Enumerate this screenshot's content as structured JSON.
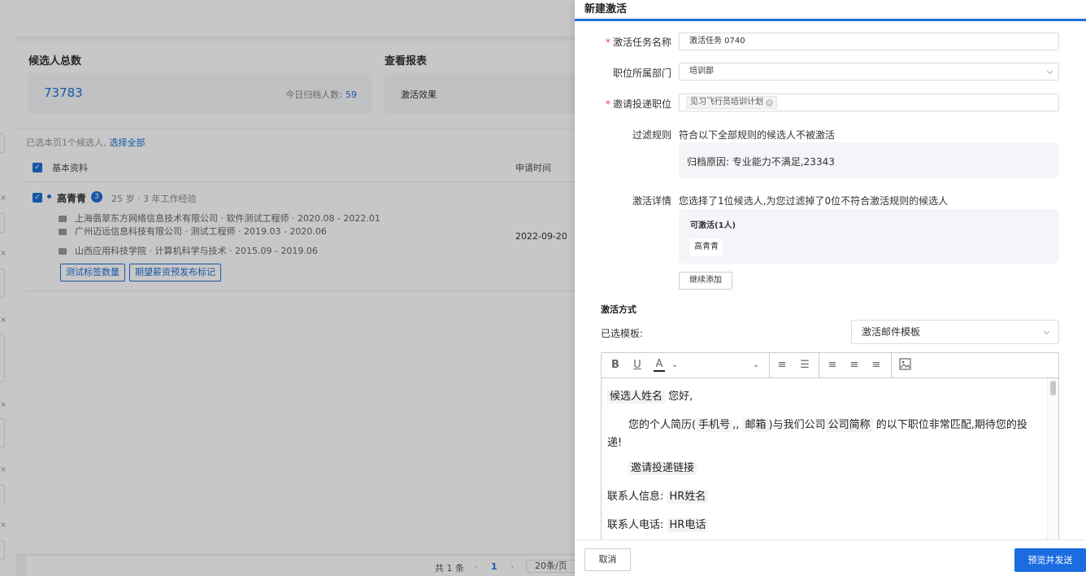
{
  "background": {
    "stats": {
      "total_title": "候选人总数",
      "total_value": "73783",
      "today_label": "今日归档人数:",
      "today_value": "59",
      "report_title": "查看报表",
      "report_item": "激活效果"
    },
    "selection": {
      "info": "已选本页1个候选人,",
      "select_all": "选择全部"
    },
    "table": {
      "col_basic": "基本资料",
      "col_apply_time": "申请时间"
    },
    "candidate": {
      "name": "高青青",
      "badge": "3",
      "meta": "25 岁 · 3 年工作经验",
      "experiences": [
        "上海翡翠东方网络信息技术有限公司 · 软件测试工程师 · 2020.08 - 2022.01",
        "广州迈远信息科技有限公司 · 测试工程师 · 2019.03 - 2020.06",
        "山西应用科技学院 · 计算机科学与技术 · 2015.09 - 2019.06"
      ],
      "tags": [
        "测试标签数量",
        "期望薪资预发布标记"
      ],
      "apply_date": "2022-09-20"
    },
    "pager": {
      "total": "共 1 条",
      "prev": "‹",
      "current": "1",
      "next": "›",
      "page_size": "20条/页"
    }
  },
  "drawer": {
    "title": "新建激活",
    "task_name": {
      "label": "激活任务名称",
      "value": "激活任务 0740"
    },
    "department": {
      "label": "职位所属部门",
      "value": "培训部"
    },
    "position": {
      "label": "邀请投递职位",
      "chip": "见习飞行员培训计划"
    },
    "filter_rules": {
      "label": "过滤规则",
      "desc": "符合以下全部规则的候选人不被激活",
      "rule": "归档原因: 专业能力不满足,23343"
    },
    "details": {
      "label": "激活详情",
      "desc": "您选择了1位候选人,为您过滤掉了0位不符合激活规则的候选人",
      "activatable": "可激活(1人)",
      "person": "高青青",
      "add_more": "继续添加"
    },
    "method": {
      "title": "激活方式",
      "template_label": "已选模板:",
      "template_value": "激活邮件模板"
    },
    "editor": {
      "toolbar": {
        "bold": "B",
        "underline": "U",
        "color": "A"
      },
      "content": {
        "name_var": "候选人姓名",
        "greeting": "您好,",
        "p2_a": "您的个人简历(",
        "phone_var": "手机号",
        "p2_b": ",,",
        "email_var": "邮箱",
        "p2_c": ")与我们公司",
        "company_var": "公司简称",
        "p2_d": "的以下职位非常匹配,期待您的投递!",
        "link_var": "邀请投递链接",
        "contact_label": "联系人信息:",
        "hr_name_var": "HR姓名",
        "phone_label": "联系人电话:",
        "hr_phone_var": "HR电话"
      }
    },
    "footer": {
      "cancel": "取消",
      "send": "预览并发送"
    }
  }
}
